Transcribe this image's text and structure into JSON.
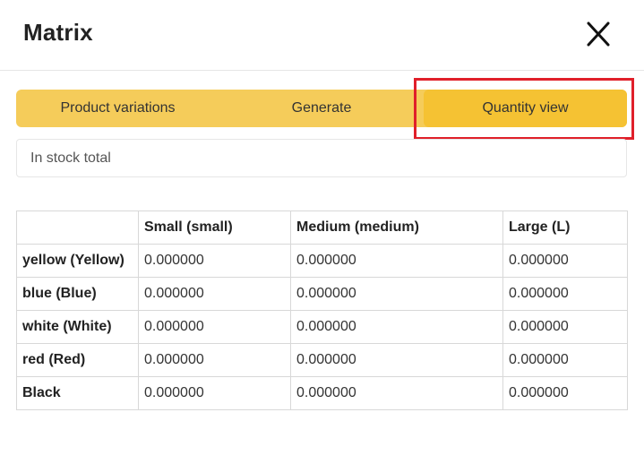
{
  "dialog": {
    "title": "Matrix",
    "close_icon": "close-icon"
  },
  "tabs": [
    {
      "label": "Product variations",
      "active": false
    },
    {
      "label": "Generate",
      "active": false
    },
    {
      "label": "Quantity view",
      "active": true
    }
  ],
  "summary": {
    "label": "In stock total"
  },
  "matrix": {
    "columns": [
      "",
      "Small (small)",
      "Medium (medium)",
      "Large (L)"
    ],
    "rows": [
      {
        "label": "yellow (Yellow)",
        "values": [
          "0.000000",
          "0.000000",
          "0.000000"
        ]
      },
      {
        "label": "blue (Blue)",
        "values": [
          "0.000000",
          "0.000000",
          "0.000000"
        ]
      },
      {
        "label": "white (White)",
        "values": [
          "0.000000",
          "0.000000",
          "0.000000"
        ]
      },
      {
        "label": "red (Red)",
        "values": [
          "0.000000",
          "0.000000",
          "0.000000"
        ]
      },
      {
        "label": "Black",
        "values": [
          "0.000000",
          "0.000000",
          "0.000000"
        ]
      }
    ]
  },
  "colors": {
    "tab_bar": "#f5cc5a",
    "tab_active": "#f5c233",
    "highlight": "#e0202a"
  }
}
